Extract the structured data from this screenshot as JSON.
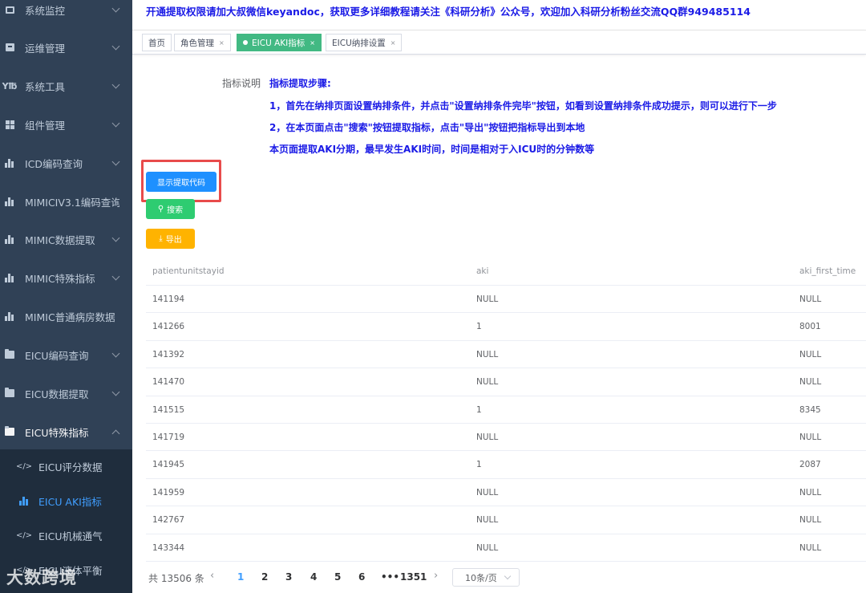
{
  "notice": "开通提取权限请加大叔微信keyandoc，获取更多详细教程请关注《科研分析》公众号，欢迎加入科研分析粉丝交流QQ群949485114",
  "sidebar": {
    "items": [
      {
        "label": "系统监控",
        "icon": "monitor-icon"
      },
      {
        "label": "运维管理",
        "icon": "box-icon"
      },
      {
        "label": "系统工具",
        "icon": "tool-icon"
      },
      {
        "label": "组件管理",
        "icon": "grid-icon"
      },
      {
        "label": "ICD编码查询",
        "icon": "bar-chart-icon"
      },
      {
        "label": "MIMICIV3.1编码查询",
        "icon": "bar-chart-icon"
      },
      {
        "label": "MIMIC数据提取",
        "icon": "bar-chart-icon"
      },
      {
        "label": "MIMIC特殊指标",
        "icon": "bar-chart-icon"
      },
      {
        "label": "MIMIC普通病房数据",
        "icon": "bar-chart-icon"
      },
      {
        "label": "EICU编码查询",
        "icon": "folder-icon"
      },
      {
        "label": "EICU数据提取",
        "icon": "folder-icon"
      },
      {
        "label": "EICU特殊指标",
        "icon": "folder-icon"
      }
    ],
    "submenu": [
      {
        "label": "EICU评分数据",
        "icon": "code-icon"
      },
      {
        "label": "EICU AKI指标",
        "icon": "bar-chart-icon"
      },
      {
        "label": "EICU机械通气",
        "icon": "code-icon"
      },
      {
        "label": "EICU液体平衡",
        "icon": "code-icon"
      }
    ]
  },
  "tags": [
    {
      "label": "首页"
    },
    {
      "label": "角色管理",
      "close": "×"
    },
    {
      "label": "EICU AKI指标",
      "close": "×"
    },
    {
      "label": "EICU纳排设置",
      "close": "×"
    }
  ],
  "description": {
    "label": "指标说明",
    "lines": [
      "指标提取步骤:",
      "1，首先在纳排页面设置纳排条件，并点击\"设置纳排条件完毕\"按钮，如看到设置纳排条件成功提示，则可以进行下一步",
      "2，在本页面点击\"搜索\"按钮提取指标，点击\"导出\"按钮把指标导出到本地",
      "本页面提取AKI分期，最早发生AKI时间，时间是相对于入ICU时的分钟数等"
    ]
  },
  "buttons": {
    "show_code": "显示提取代码",
    "search": "搜索",
    "export": "导出"
  },
  "table": {
    "columns": [
      "patientunitstayid",
      "aki",
      "aki_first_time"
    ],
    "rows": [
      [
        "141194",
        "NULL",
        "NULL"
      ],
      [
        "141266",
        "1",
        "8001"
      ],
      [
        "141392",
        "NULL",
        "NULL"
      ],
      [
        "141470",
        "NULL",
        "NULL"
      ],
      [
        "141515",
        "1",
        "8345"
      ],
      [
        "141719",
        "NULL",
        "NULL"
      ],
      [
        "141945",
        "1",
        "2087"
      ],
      [
        "141959",
        "NULL",
        "NULL"
      ],
      [
        "142767",
        "NULL",
        "NULL"
      ],
      [
        "143344",
        "NULL",
        "NULL"
      ]
    ]
  },
  "pagination": {
    "total": "共 13506 条",
    "pages": [
      "1",
      "2",
      "3",
      "4",
      "5",
      "6",
      "•••",
      "1351"
    ],
    "current": "1",
    "page_size": "10条/页"
  },
  "watermark": "大数跨境",
  "colors": {
    "sidebar_bg": "#304156",
    "submenu_bg": "#1f2d3d",
    "active_tag": "#42b983",
    "primary": "#1e90ff",
    "success": "#2ecc71",
    "warning": "#ffb300",
    "notice_text": "#1a1ae6",
    "highlight": "#e84b4b"
  }
}
